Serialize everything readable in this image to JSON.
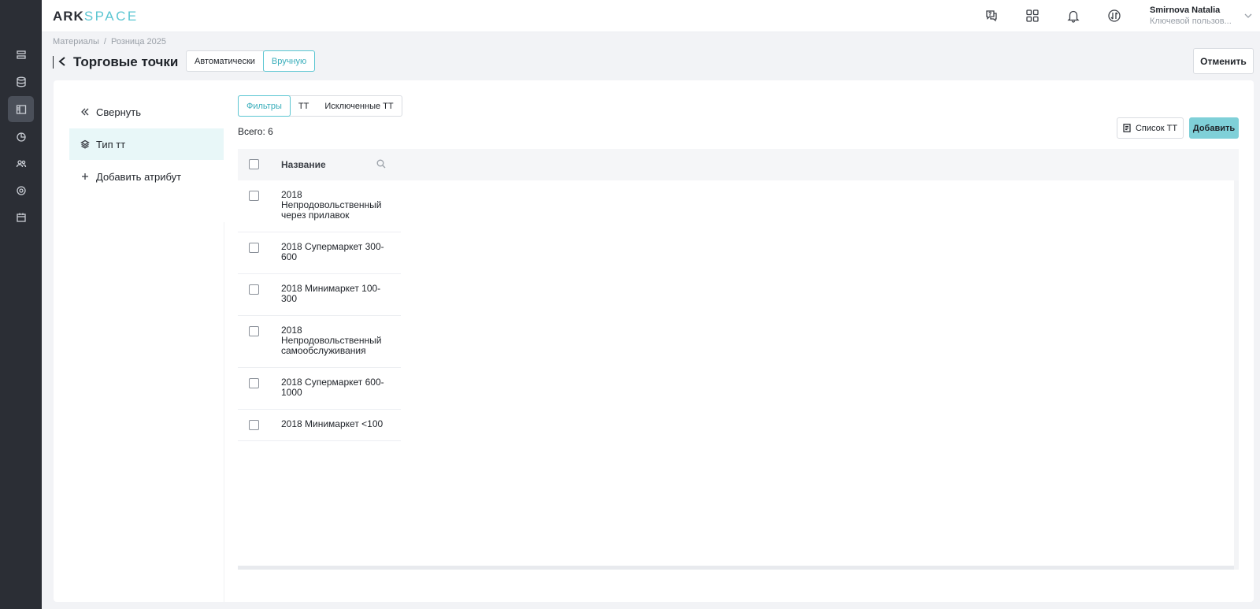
{
  "app": {
    "logo_bold": "ARK",
    "logo_light": "SPACE"
  },
  "rail": {
    "items": [
      {
        "icon": "tasks-icon",
        "active": false
      },
      {
        "icon": "database-icon",
        "active": false
      },
      {
        "icon": "layout-icon",
        "active": true
      },
      {
        "icon": "chart-icon",
        "active": false
      },
      {
        "icon": "users-icon",
        "active": false
      },
      {
        "icon": "gear-icon",
        "active": false
      },
      {
        "icon": "calendar-icon",
        "active": false
      }
    ]
  },
  "topbar": {
    "icons": [
      "help-chat-icon",
      "apps-grid-icon",
      "bell-icon",
      "sync-icon"
    ],
    "user_name": "Smirnova Natalia",
    "user_role": "Ключевой пользов..."
  },
  "breadcrumb": {
    "items": [
      "Материалы",
      "Розница 2025"
    ],
    "separator": "/"
  },
  "header": {
    "title": "Торговые точки",
    "mode_auto": "Автоматически",
    "mode_manual": "Вручную",
    "cancel": "Отменить"
  },
  "sidebar": {
    "collapse": "Свернуть",
    "items": [
      {
        "label": "Тип тт",
        "active": true
      }
    ],
    "add_attribute": "Добавить атрибут"
  },
  "tabs": [
    {
      "label": "Фильтры",
      "active": true
    },
    {
      "label": "ТТ",
      "active": false
    },
    {
      "label": "Исключенные ТТ",
      "active": false
    }
  ],
  "summary": {
    "total": "Всего: 6"
  },
  "actions": {
    "list": "Список ТТ",
    "add": "Добавить"
  },
  "table": {
    "columns": [
      "Название"
    ],
    "rows": [
      "2018 Непродовольственный через прилавок",
      "2018 Супермаркет 300-600",
      "2018 Минимаркет 100-300",
      "2018 Непродовольственный самообслуживания",
      "2018 Супермаркет 600-1000",
      "2018 Минимаркет <100"
    ]
  },
  "colors": {
    "accent": "#5bc6d2",
    "rail_bg": "#2b2e35",
    "active_row_bg": "#e8f7f8",
    "add_button": "#7fd0d8"
  }
}
